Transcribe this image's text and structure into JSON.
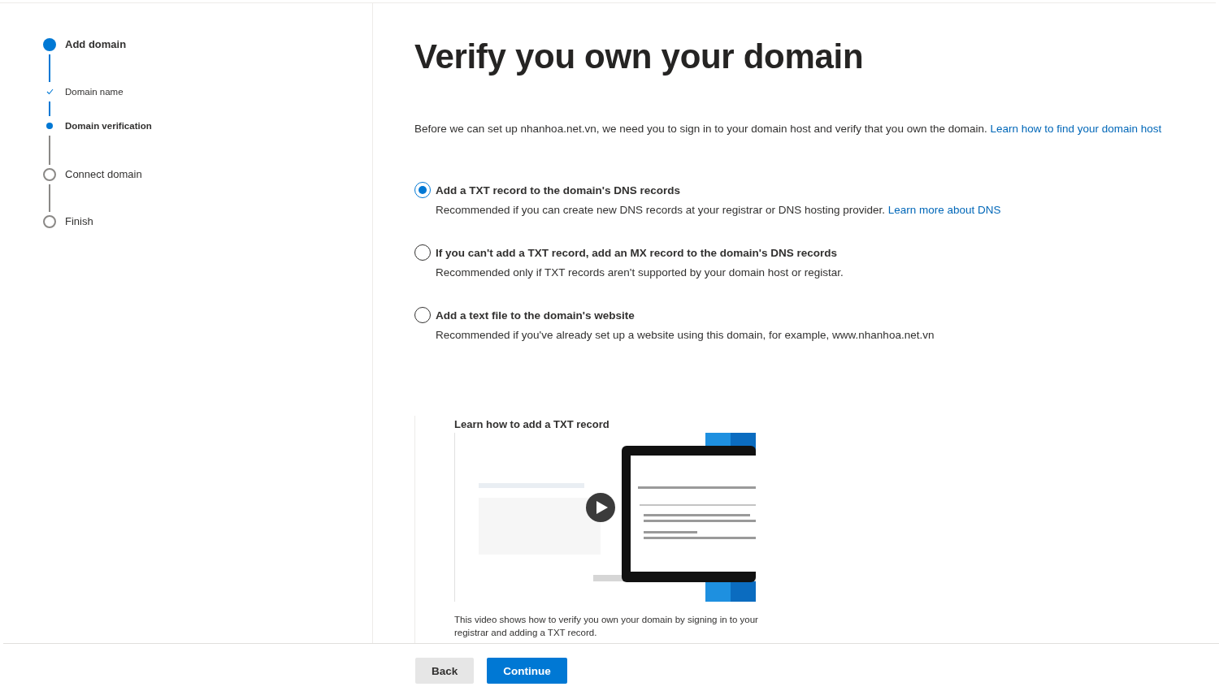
{
  "steps": [
    {
      "label": "Add domain",
      "current": true,
      "children": [
        {
          "label": "Domain name",
          "done": true,
          "current": false
        },
        {
          "label": "Domain verification",
          "done": false,
          "current": true
        }
      ]
    },
    {
      "label": "Connect domain",
      "current": false
    },
    {
      "label": "Finish",
      "current": false
    }
  ],
  "title": "Verify you own your domain",
  "intro": {
    "text": "Before we can set up nhanhoa.net.vn, we need you to sign in to your domain host and verify that you own the domain.",
    "link": "Learn how to find your domain host"
  },
  "options": [
    {
      "label": "Add a TXT record to the domain's DNS records",
      "description": "Recommended if you can create new DNS records at your registrar or DNS hosting provider.",
      "link": "Learn more about DNS",
      "selected": true
    },
    {
      "label": "If you can't add a TXT record, add an MX record to the domain's DNS records",
      "description": "Recommended only if TXT records aren't supported by your domain host or registar.",
      "selected": false
    },
    {
      "label": "Add a text file to the domain's website",
      "description": "Recommended if you've already set up a website using this domain, for example, www.nhanhoa.net.vn",
      "selected": false
    }
  ],
  "video": {
    "title": "Learn how to add a TXT record",
    "caption": "This video shows how to verify you own your domain by signing in to your registrar and adding a TXT record."
  },
  "buttons": [
    {
      "label": "Back",
      "kind": "secondary"
    },
    {
      "label": "Continue",
      "kind": "primary"
    }
  ]
}
